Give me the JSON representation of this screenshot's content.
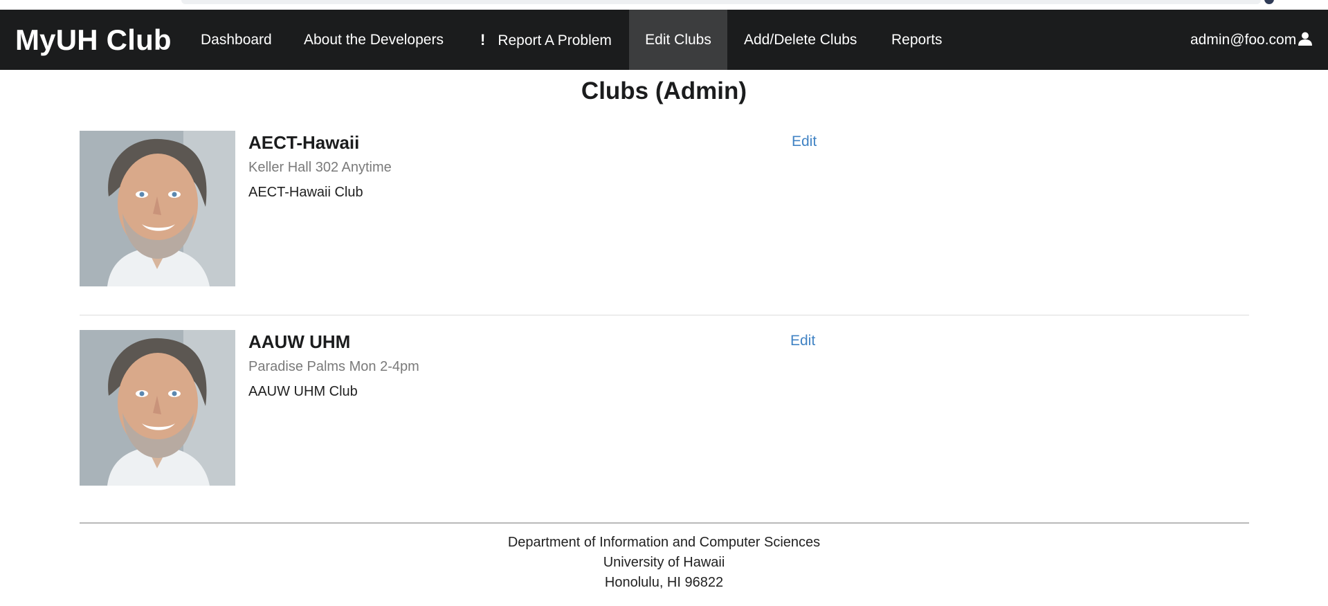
{
  "navbar": {
    "brand": "MyUH Club",
    "items": [
      {
        "label": "Dashboard"
      },
      {
        "label": "About the Developers"
      },
      {
        "label": "Report A Problem",
        "icon": "exclamation-icon"
      },
      {
        "label": "Edit Clubs",
        "active": true
      },
      {
        "label": "Add/Delete Clubs"
      },
      {
        "label": "Reports"
      }
    ],
    "user": {
      "email": "admin@foo.com",
      "icon": "user-icon"
    }
  },
  "page": {
    "title": "Clubs (Admin)"
  },
  "clubs": [
    {
      "name": "AECT-Hawaii",
      "meta": "Keller Hall 302 Anytime",
      "description": "AECT-Hawaii Club",
      "edit_label": "Edit"
    },
    {
      "name": "AAUW UHM",
      "meta": "Paradise Palms Mon 2-4pm",
      "description": "AAUW UHM Club",
      "edit_label": "Edit"
    }
  ],
  "footer": {
    "line1": "Department of Information and Computer Sciences",
    "line2": "University of Hawaii",
    "line3": "Honolulu, HI 96822"
  },
  "colors": {
    "navbar_bg": "#1b1c1d",
    "active_bg": "#3c3d3e",
    "link": "#4183c4"
  }
}
